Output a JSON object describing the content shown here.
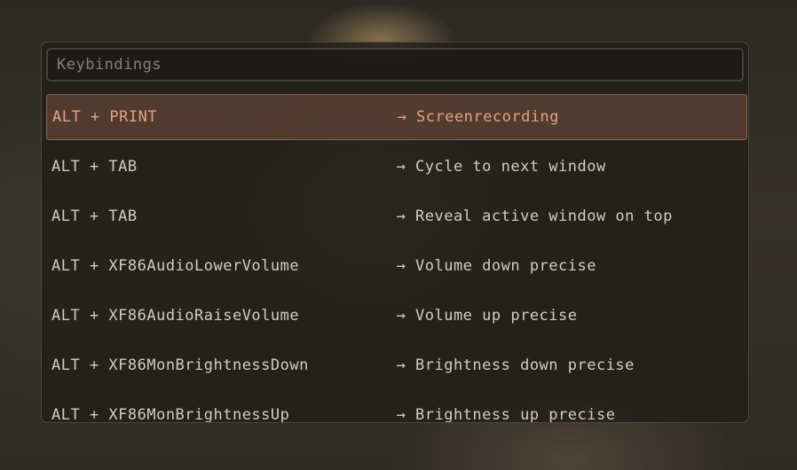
{
  "search": {
    "placeholder": "Keybindings"
  },
  "bindings": [
    {
      "key": "ALT + PRINT",
      "arrow": "→",
      "action": "Screenrecording",
      "selected": true
    },
    {
      "key": "ALT + TAB",
      "arrow": "→",
      "action": "Cycle to next window",
      "selected": false
    },
    {
      "key": "ALT + TAB",
      "arrow": "→",
      "action": "Reveal active window on top",
      "selected": false
    },
    {
      "key": "ALT + XF86AudioLowerVolume",
      "arrow": "→",
      "action": "Volume down precise",
      "selected": false
    },
    {
      "key": "ALT + XF86AudioRaiseVolume",
      "arrow": "→",
      "action": "Volume up precise",
      "selected": false
    },
    {
      "key": "ALT + XF86MonBrightnessDown",
      "arrow": "→",
      "action": "Brightness down precise",
      "selected": false
    },
    {
      "key": "ALT + XF86MonBrightnessUp",
      "arrow": "→",
      "action": "Brightness up precise",
      "selected": false
    }
  ],
  "colors": {
    "selected_text": "#e2a286",
    "selected_background": "#78523e",
    "text": "#d2ccc3"
  }
}
